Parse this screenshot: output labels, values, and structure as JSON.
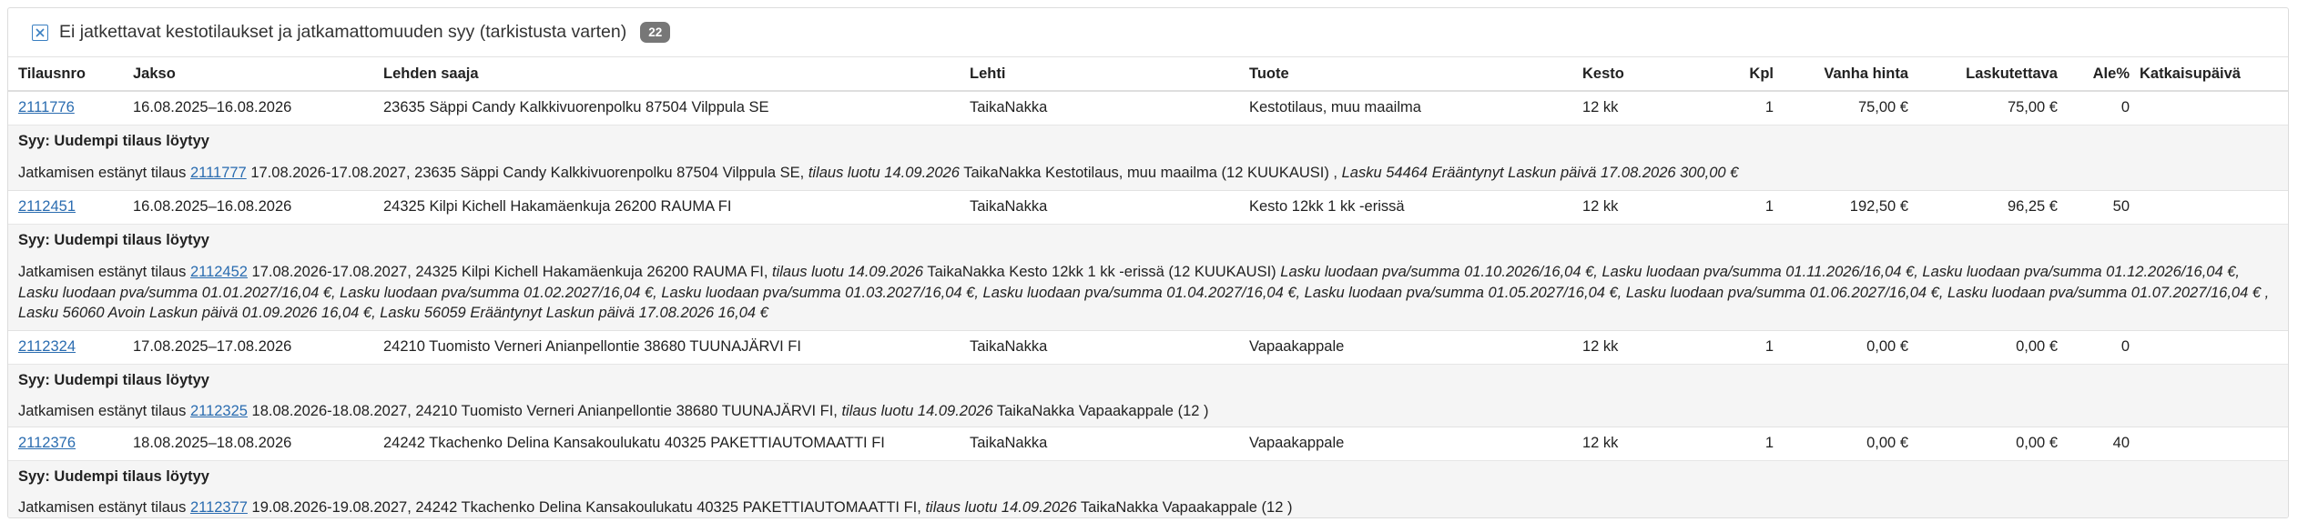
{
  "panel": {
    "title": "Ei jatkettavat kestotilaukset ja jatkamattomuuden syy (tarkistusta varten)",
    "count": "22",
    "accent": "#3a7fc1"
  },
  "columns": {
    "order": "Tilausnro",
    "period": "Jakso",
    "recipient": "Lehden saaja",
    "magazine": "Lehti",
    "product": "Tuote",
    "duration": "Kesto",
    "qty": "Kpl",
    "old_price": "Vanha hinta",
    "billable": "Laskutettava",
    "discount": "Ale%",
    "cutoff": "Katkaisupäivä"
  },
  "rows": [
    {
      "order": "2111776",
      "period": "16.08.2025–16.08.2026",
      "recipient": "23635 Säppi Candy Kalkkivuorenpolku 87504 Vilppula SE",
      "magazine": "TaikaNakka",
      "product": "Kestotilaus, muu maailma",
      "duration": "12 kk",
      "qty": "1",
      "old_price": "75,00 €",
      "billable": "75,00 €",
      "discount": "0",
      "cutoff": "",
      "reason": "Syy: Uudempi tilaus löytyy",
      "detail": {
        "prefix": "Jatkamisen estänyt tilaus",
        "link": "2111777",
        "text": "17.08.2026-17.08.2027, 23635 Säppi Candy Kalkkivuorenpolku 87504 Vilppula SE,",
        "created": "tilaus luotu 14.09.2026",
        "product": "TaikaNakka Kestotilaus, muu maailma (12 KUUKAUSI) ,",
        "tail": "Lasku 54464 Erääntynyt Laskun päivä 17.08.2026 300,00 €"
      }
    },
    {
      "order": "2112451",
      "period": "16.08.2025–16.08.2026",
      "recipient": "24325 Kilpi Kichell Hakamäenkuja 26200 RAUMA FI",
      "magazine": "TaikaNakka",
      "product": "Kesto 12kk 1 kk -erissä",
      "duration": "12 kk",
      "qty": "1",
      "old_price": "192,50 €",
      "billable": "96,25 €",
      "discount": "50",
      "cutoff": "",
      "reason": "Syy: Uudempi tilaus löytyy",
      "detail": {
        "prefix": "Jatkamisen estänyt tilaus",
        "link": "2112452",
        "text": "17.08.2026-17.08.2027, 24325 Kilpi Kichell Hakamäenkuja 26200 RAUMA FI,",
        "created": "tilaus luotu 14.09.2026",
        "product": "TaikaNakka Kesto 12kk 1 kk -erissä (12 KUUKAUSI)",
        "tail": "Lasku luodaan pva/summa 01.10.2026/16,04 €, Lasku luodaan pva/summa 01.11.2026/16,04 €, Lasku luodaan pva/summa 01.12.2026/16,04 €, Lasku luodaan pva/summa 01.01.2027/16,04 €, Lasku luodaan pva/summa 01.02.2027/16,04 €, Lasku luodaan pva/summa 01.03.2027/16,04 €, Lasku luodaan pva/summa 01.04.2027/16,04 €, Lasku luodaan pva/summa 01.05.2027/16,04 €, Lasku luodaan pva/summa 01.06.2027/16,04 €, Lasku luodaan pva/summa 01.07.2027/16,04 € , Lasku 56060 Avoin Laskun päivä 01.09.2026 16,04 €, Lasku 56059 Erääntynyt Laskun päivä 17.08.2026 16,04 €"
      }
    },
    {
      "order": "2112324",
      "period": "17.08.2025–17.08.2026",
      "recipient": "24210 Tuomisto Verneri Anianpellontie 38680 TUUNAJÄRVI FI",
      "magazine": "TaikaNakka",
      "product": "Vapaakappale",
      "duration": "12 kk",
      "qty": "1",
      "old_price": "0,00 €",
      "billable": "0,00 €",
      "discount": "0",
      "cutoff": "",
      "reason": "Syy: Uudempi tilaus löytyy",
      "detail": {
        "prefix": "Jatkamisen estänyt tilaus",
        "link": "2112325",
        "text": "18.08.2026-18.08.2027, 24210 Tuomisto Verneri Anianpellontie 38680 TUUNAJÄRVI FI,",
        "created": "tilaus luotu 14.09.2026",
        "product": "TaikaNakka Vapaakappale (12 )",
        "tail": ""
      }
    },
    {
      "order": "2112376",
      "period": "18.08.2025–18.08.2026",
      "recipient": "24242 Tkachenko Delina Kansakoulukatu 40325 PAKETTIAUTOMAATTI FI",
      "magazine": "TaikaNakka",
      "product": "Vapaakappale",
      "duration": "12 kk",
      "qty": "1",
      "old_price": "0,00 €",
      "billable": "0,00 €",
      "discount": "40",
      "cutoff": "",
      "reason": "Syy: Uudempi tilaus löytyy",
      "detail": {
        "prefix": "Jatkamisen estänyt tilaus",
        "link": "2112377",
        "text": "19.08.2026-19.08.2027, 24242 Tkachenko Delina Kansakoulukatu 40325 PAKETTIAUTOMAATTI FI,",
        "created": "tilaus luotu 14.09.2026",
        "product": "TaikaNakka Vapaakappale (12 )",
        "tail": ""
      }
    }
  ]
}
